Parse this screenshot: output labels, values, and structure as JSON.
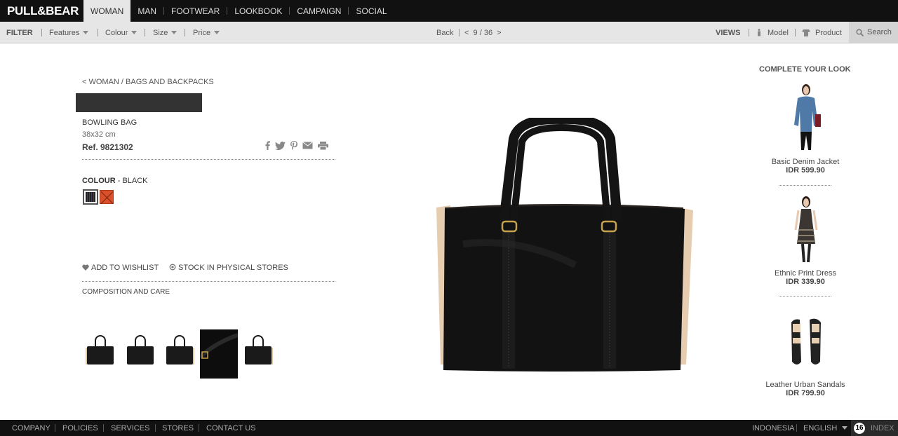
{
  "brand": "PULL&BEAR",
  "nav": [
    "WOMAN",
    "MAN",
    "FOOTWEAR",
    "LOOKBOOK",
    "CAMPAIGN",
    "SOCIAL"
  ],
  "filter": {
    "label": "FILTER",
    "items": [
      "Features",
      "Colour",
      "Size",
      "Price"
    ],
    "back": "Back",
    "pager": "<  9 / 36  >",
    "views_label": "VIEWS",
    "model": "Model",
    "product": "Product",
    "search": "Search"
  },
  "product": {
    "breadcrumb": "< WOMAN / BAGS AND BACKPACKS",
    "name": "BOWLING BAG",
    "size": "38x32 cm",
    "ref": "Ref. 9821302",
    "colour_label": "COLOUR",
    "colour_value": " - BLACK",
    "wishlist": "ADD TO WISHLIST",
    "stock": "STOCK IN PHYSICAL STORES",
    "composition": "COMPOSITION AND CARE"
  },
  "complete_look": {
    "title": "COMPLETE YOUR LOOK",
    "items": [
      {
        "name": "Basic Denim Jacket",
        "price": "IDR 599.90"
      },
      {
        "name": "Ethnic Print Dress",
        "price": "IDR 339.90"
      },
      {
        "name": "Leather Urban Sandals",
        "price": "IDR 799.90"
      }
    ]
  },
  "footer": {
    "links": [
      "COMPANY",
      "POLICIES",
      "SERVICES",
      "STORES",
      "CONTACT US"
    ],
    "country": "INDONESIA",
    "language": "ENGLISH",
    "index_count": "16",
    "index_label": "INDEX"
  },
  "colors": {
    "topbar": "#111111",
    "filterbar": "#e6e6e6",
    "swatch_orange": "#d9502a"
  }
}
